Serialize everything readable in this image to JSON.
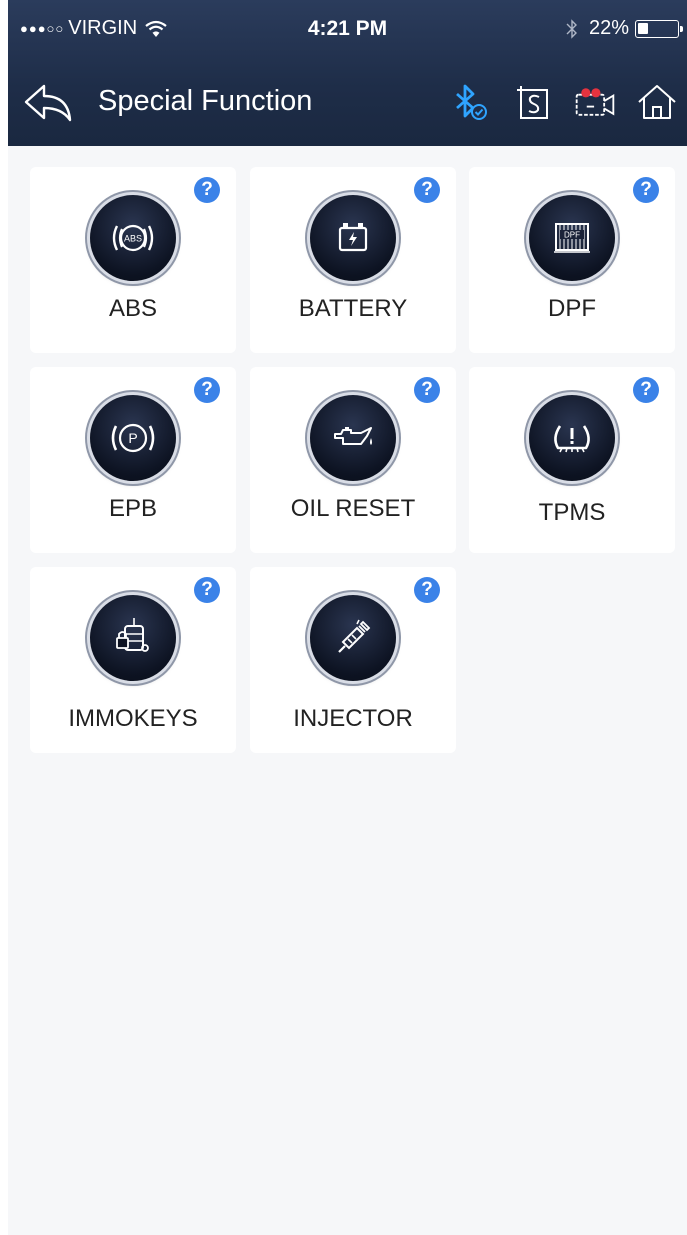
{
  "status_bar": {
    "signal_dots": "●●●○○",
    "carrier": "VIRGIN",
    "time": "4:21 PM",
    "battery_percent": "22%",
    "icons": [
      "wifi-icon",
      "bluetooth-icon",
      "battery-icon"
    ]
  },
  "nav": {
    "title": "Special Function",
    "icons": [
      "back-arrow-icon",
      "bluetooth-connected-icon",
      "screenshot-icon",
      "video-record-icon",
      "home-icon"
    ],
    "accent_color": "#2fa4ff"
  },
  "help_symbol": "?",
  "functions": [
    {
      "label": "ABS",
      "icon": "abs-icon"
    },
    {
      "label": "BATTERY",
      "icon": "battery-icon"
    },
    {
      "label": "DPF",
      "icon": "dpf-icon"
    },
    {
      "label": "EPB",
      "icon": "parking-brake-icon"
    },
    {
      "label": "OIL RESET",
      "icon": "oil-can-icon"
    },
    {
      "label": "TPMS",
      "icon": "tire-pressure-icon"
    },
    {
      "label": "IMMOKEYS",
      "icon": "immobilizer-key-icon"
    },
    {
      "label": "INJECTOR",
      "icon": "injector-icon"
    }
  ],
  "colors": {
    "header_bg": "#1e2d48",
    "page_bg": "#f6f7f9",
    "help_badge": "#3a82e8",
    "record_red": "#e5333f"
  }
}
